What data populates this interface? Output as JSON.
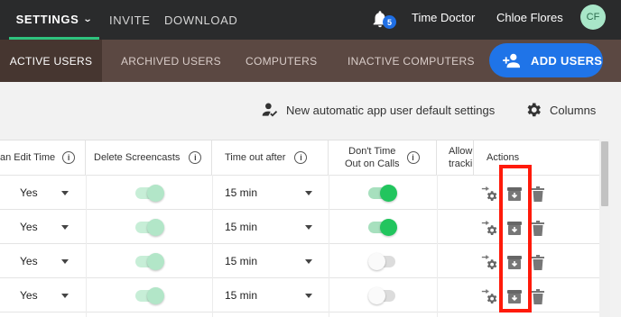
{
  "topbar": {
    "nav": [
      {
        "label": "SETTINGS",
        "active": true,
        "has_dropdown": true
      },
      {
        "label": "INVITE"
      },
      {
        "label": "DOWNLOAD"
      }
    ],
    "notifications_count": "5",
    "company": "Time Doctor",
    "user_name": "Chloe Flores",
    "avatar_initials": "CF"
  },
  "subtabs": [
    {
      "label": "ACTIVE USERS",
      "active": true
    },
    {
      "label": "ARCHIVED USERS"
    },
    {
      "label": "COMPUTERS"
    },
    {
      "label": "INACTIVE COMPUTERS"
    }
  ],
  "add_users_label": "ADD USERS",
  "toolbar": {
    "new_auto_label": "New automatic app user default settings",
    "columns_label": "Columns"
  },
  "table": {
    "headers": {
      "can_edit_time": "an Edit Time",
      "delete_screencasts": "Delete Screencasts",
      "time_out_after": "Time out after",
      "dont_time_calls_1": "Don't Time",
      "dont_time_calls_2": "Out on Calls",
      "allow_1": "Allow",
      "allow_2": "tracki",
      "actions": "Actions"
    },
    "rows": [
      {
        "can_edit": "Yes",
        "delete_screencasts": "on-light",
        "timeout": "15 min",
        "dont_time_calls": "on"
      },
      {
        "can_edit": "Yes",
        "delete_screencasts": "on-light",
        "timeout": "15 min",
        "dont_time_calls": "on"
      },
      {
        "can_edit": "Yes",
        "delete_screencasts": "on-light",
        "timeout": "15 min",
        "dont_time_calls": "off"
      },
      {
        "can_edit": "Yes",
        "delete_screencasts": "on-light",
        "timeout": "15 min",
        "dont_time_calls": "off"
      }
    ]
  },
  "colors": {
    "topbar_bg": "#2a2b2c",
    "subbar_bg": "#5b4842",
    "accent_green": "#22c55e",
    "button_blue": "#1f74e8",
    "highlight_red": "#ff1a0a"
  },
  "icons": {
    "bell": "bell-icon",
    "add_user": "add-user-icon",
    "user_check": "user-check-icon",
    "gear": "gear-icon",
    "info": "info-icon",
    "transfer_settings": "transfer-settings-icon",
    "archive": "archive-icon",
    "delete": "trash-icon"
  }
}
